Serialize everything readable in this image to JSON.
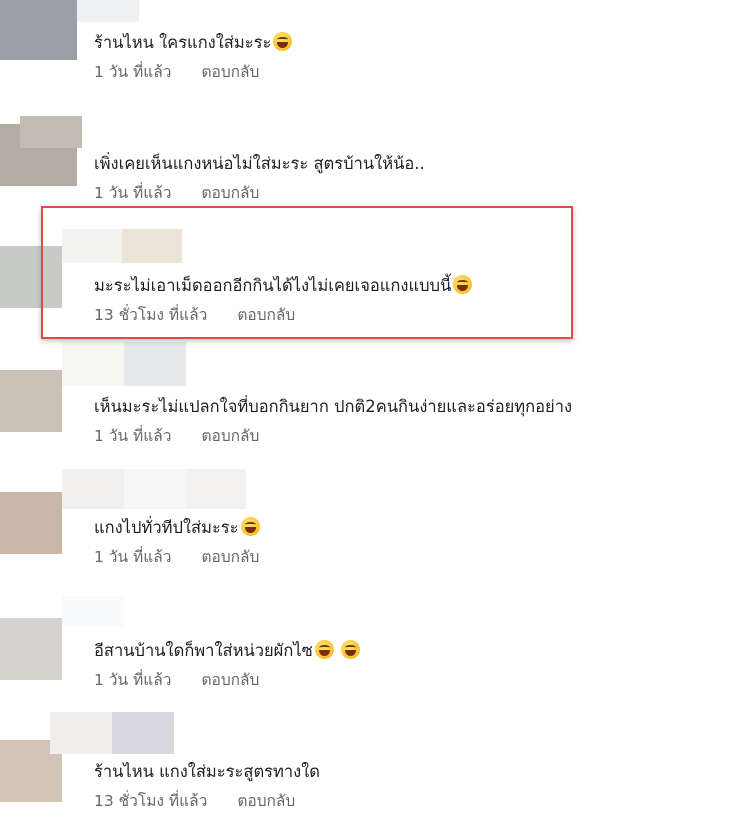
{
  "comments": [
    {
      "text": "ร้านไหน ใครแกงใส่มะระ",
      "emoji": true,
      "time": "1 วัน ที่แล้ว",
      "reply": "ตอบกลับ"
    },
    {
      "text": "เพิ่งเคยเห็นแกงหน่อไม่ใส่มะระ สูตรบ้านให้น้อ..",
      "emoji": false,
      "time": "1 วัน ที่แล้ว",
      "reply": "ตอบกลับ"
    },
    {
      "text": "มะระไม่เอาเม็ดออกอีกกินได้ไงไม่เคยเจอแกงแบบนี้",
      "emoji": true,
      "time": "13 ชั่วโมง ที่แล้ว",
      "reply": "ตอบกลับ"
    },
    {
      "text": "เห็นมะระไม่แปลกใจที่บอกกินยาก ปกติ2คนกินง่ายและอร่อยทุกอย่าง",
      "emoji": false,
      "time": "1 วัน ที่แล้ว",
      "reply": "ตอบกลับ"
    },
    {
      "text": "แกงไปทั่วทีปใส่มะระ",
      "emoji": true,
      "time": "1 วัน ที่แล้ว",
      "reply": "ตอบกลับ"
    },
    {
      "text": "อีสานบ้านใดก็พาใส่หน่วยผักไซ",
      "emoji": true,
      "emoji2": true,
      "time": "1 วัน ที่แล้ว",
      "reply": "ตอบกลับ"
    },
    {
      "text": "ร้านไหน แกงใส่มะระสูตรทางใด",
      "emoji": false,
      "time": "13 ชั่วโมง ที่แล้ว",
      "reply": "ตอบกลับ"
    }
  ],
  "emoji_name": "laughing-tears-emoji",
  "colors": {
    "text": "#1c1e21",
    "meta": "#65676b",
    "highlight": "#e04a4a"
  }
}
